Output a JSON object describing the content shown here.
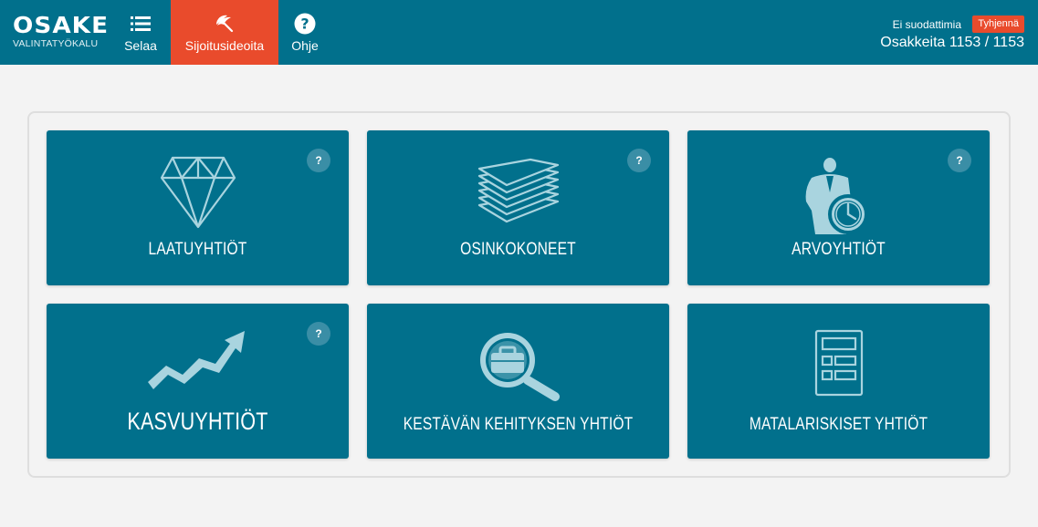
{
  "logo": {
    "main": "OSAKE",
    "sub": "VALINTATYÖKALU"
  },
  "nav": {
    "browse": "Selaa",
    "ideas": "Sijoitusideoita",
    "help": "Ohje"
  },
  "filters": {
    "status": "Ei suodattimia",
    "clear_label": "Tyhjennä",
    "count_text": "Osakkeita 1153 / 1153"
  },
  "cards": [
    {
      "title": "LAATUYHTIÖT",
      "help": "?",
      "icon": "diamond-icon"
    },
    {
      "title": "OSINKOKONEET",
      "help": "?",
      "icon": "paper-stack-icon"
    },
    {
      "title": "ARVOYHTIÖT",
      "help": "?",
      "icon": "businessman-clock-icon"
    },
    {
      "title": "KASVUYHTIÖT",
      "help": "?",
      "icon": "growth-arrow-icon"
    },
    {
      "title": "KESTÄVÄN KEHITYKSEN YHTIÖT",
      "icon": "magnifier-briefcase-icon"
    },
    {
      "title": "MATALARISKISET YHTIÖT",
      "icon": "calculator-icon"
    }
  ],
  "colors": {
    "primary": "#01708c",
    "accent": "#e94b2c",
    "background": "#f3f3f3"
  }
}
